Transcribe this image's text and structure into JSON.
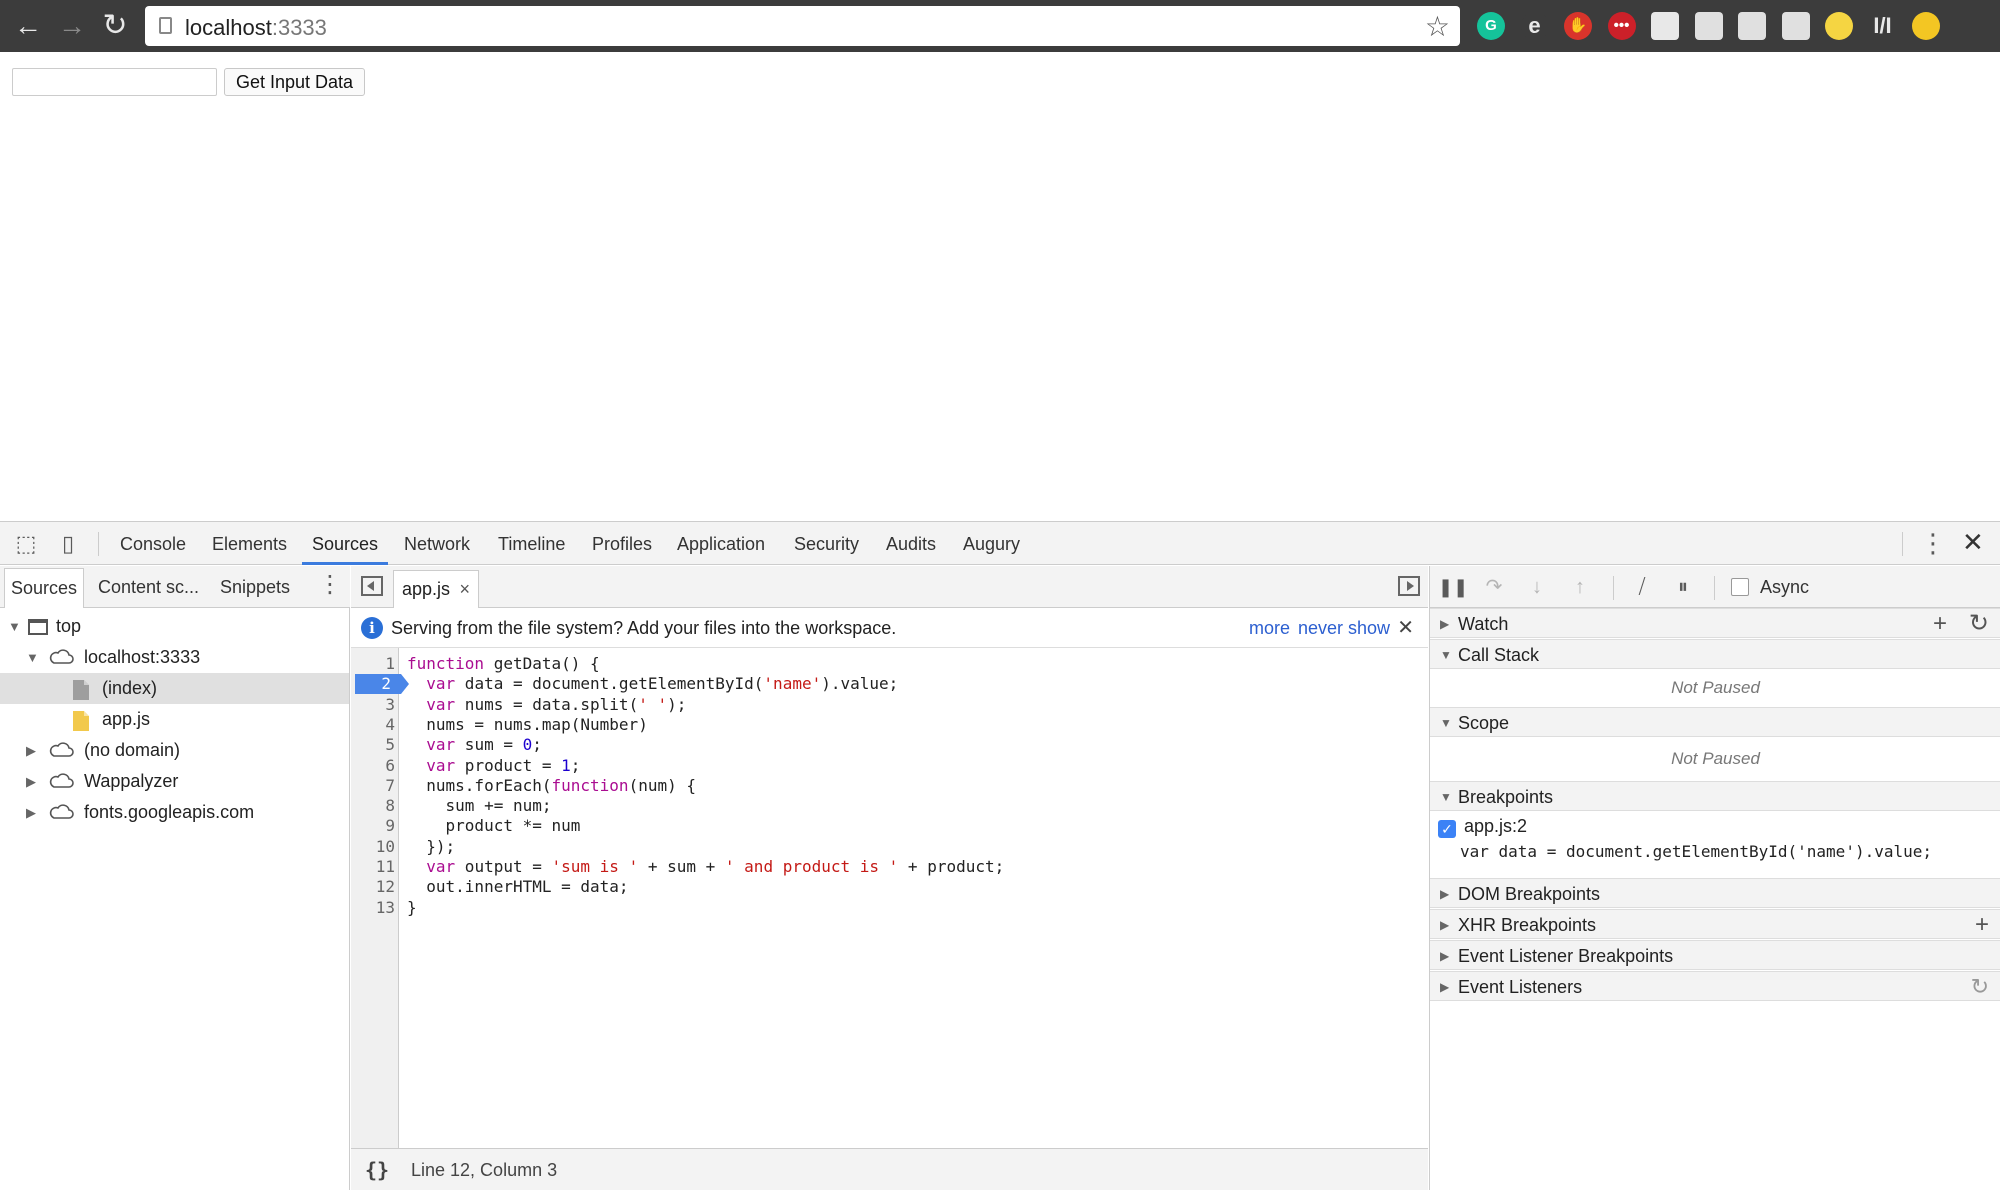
{
  "browser": {
    "url_host": "localhost",
    "url_port": ":3333",
    "extensions": [
      {
        "name": "grammarly-icon",
        "glyph": "G",
        "color": "#15c39a"
      },
      {
        "name": "edge-icon",
        "glyph": "e",
        "color": "#3c3c3c"
      },
      {
        "name": "stop-icon",
        "glyph": "✋",
        "color": "#d9342b"
      },
      {
        "name": "lastpass-icon",
        "glyph": "•••",
        "color": "#cc2029"
      },
      {
        "name": "circle-ext-icon",
        "glyph": "",
        "color": "#e8e8e8"
      },
      {
        "name": "settings-ext-icon",
        "glyph": "",
        "color": "#e0e0e0"
      },
      {
        "name": "reader-ext-icon",
        "glyph": "",
        "color": "#e0e0e0"
      },
      {
        "name": "translate-ext-icon",
        "glyph": "",
        "color": "#e0e0e0"
      },
      {
        "name": "pen-ext-icon",
        "glyph": "",
        "color": "#f5d542"
      },
      {
        "name": "stats-ext-icon",
        "glyph": "I/I",
        "color": "#3c3c3c"
      },
      {
        "name": "moon-ext-icon",
        "glyph": "",
        "color": "#f3c623"
      }
    ]
  },
  "page": {
    "input_value": "",
    "button_label": "Get Input Data"
  },
  "devtools": {
    "tabs": [
      "Console",
      "Elements",
      "Sources",
      "Network",
      "Timeline",
      "Profiles",
      "Application",
      "Security",
      "Audits",
      "Augury"
    ],
    "active_tab": "Sources",
    "navigator": {
      "tabs": [
        "Sources",
        "Content sc...",
        "Snippets"
      ],
      "tree": [
        {
          "label": "top",
          "type": "frame",
          "level": 0,
          "expanded": true
        },
        {
          "label": "localhost:3333",
          "type": "cloud",
          "level": 1,
          "expanded": true
        },
        {
          "label": "(index)",
          "type": "file-gray",
          "level": 2,
          "selected": true
        },
        {
          "label": "app.js",
          "type": "file-yellow",
          "level": 2
        },
        {
          "label": "(no domain)",
          "type": "cloud",
          "level": 1,
          "expanded": false
        },
        {
          "label": "Wappalyzer",
          "type": "cloud",
          "level": 1,
          "expanded": false
        },
        {
          "label": "fonts.googleapis.com",
          "type": "cloud",
          "level": 1,
          "expanded": false
        }
      ]
    },
    "editor": {
      "file_tab": "app.js",
      "info_message": "Serving from the file system? Add your files into the workspace.",
      "info_more": "more",
      "info_never": "never show",
      "breakpoint_line": 2,
      "lines": [
        [
          [
            "kw",
            "function"
          ],
          [
            "t",
            " getData() {"
          ]
        ],
        [
          [
            "t",
            "  "
          ],
          [
            "kw",
            "var"
          ],
          [
            "t",
            " data = document.getElementById("
          ],
          [
            "str",
            "'name'"
          ],
          [
            "t",
            ").value;"
          ]
        ],
        [
          [
            "t",
            "  "
          ],
          [
            "kw",
            "var"
          ],
          [
            "t",
            " nums = data.split("
          ],
          [
            "str",
            "' '"
          ],
          [
            "t",
            ");"
          ]
        ],
        [
          [
            "t",
            "  nums = nums.map(Number)"
          ]
        ],
        [
          [
            "t",
            "  "
          ],
          [
            "kw",
            "var"
          ],
          [
            "t",
            " sum = "
          ],
          [
            "num",
            "0"
          ],
          [
            "t",
            ";"
          ]
        ],
        [
          [
            "t",
            "  "
          ],
          [
            "kw",
            "var"
          ],
          [
            "t",
            " product = "
          ],
          [
            "num",
            "1"
          ],
          [
            "t",
            ";"
          ]
        ],
        [
          [
            "t",
            "  nums.forEach("
          ],
          [
            "kw",
            "function"
          ],
          [
            "t",
            "(num) {"
          ]
        ],
        [
          [
            "t",
            "    sum += num;"
          ]
        ],
        [
          [
            "t",
            "    product *= num"
          ]
        ],
        [
          [
            "t",
            "  });"
          ]
        ],
        [
          [
            "t",
            "  "
          ],
          [
            "kw",
            "var"
          ],
          [
            "t",
            " output = "
          ],
          [
            "str",
            "'sum is '"
          ],
          [
            "t",
            " + sum + "
          ],
          [
            "str",
            "' and product is '"
          ],
          [
            "t",
            " + product;"
          ]
        ],
        [
          [
            "t",
            "  out.innerHTML = data;"
          ]
        ],
        [
          [
            "t",
            "}"
          ]
        ]
      ],
      "status_pretty": "{}",
      "status_cursor": "Line 12, Column 3"
    },
    "debugger": {
      "async_label": "Async",
      "panes": {
        "watch": "Watch",
        "call_stack": "Call Stack",
        "call_stack_status": "Not Paused",
        "scope": "Scope",
        "scope_status": "Not Paused",
        "breakpoints": "Breakpoints",
        "breakpoint_label": "app.js:2",
        "breakpoint_code": "var data = document.getElementById('name').value;",
        "dom_breakpoints": "DOM Breakpoints",
        "xhr_breakpoints": "XHR Breakpoints",
        "event_listener_breakpoints": "Event Listener Breakpoints",
        "event_listeners": "Event Listeners"
      }
    }
  }
}
